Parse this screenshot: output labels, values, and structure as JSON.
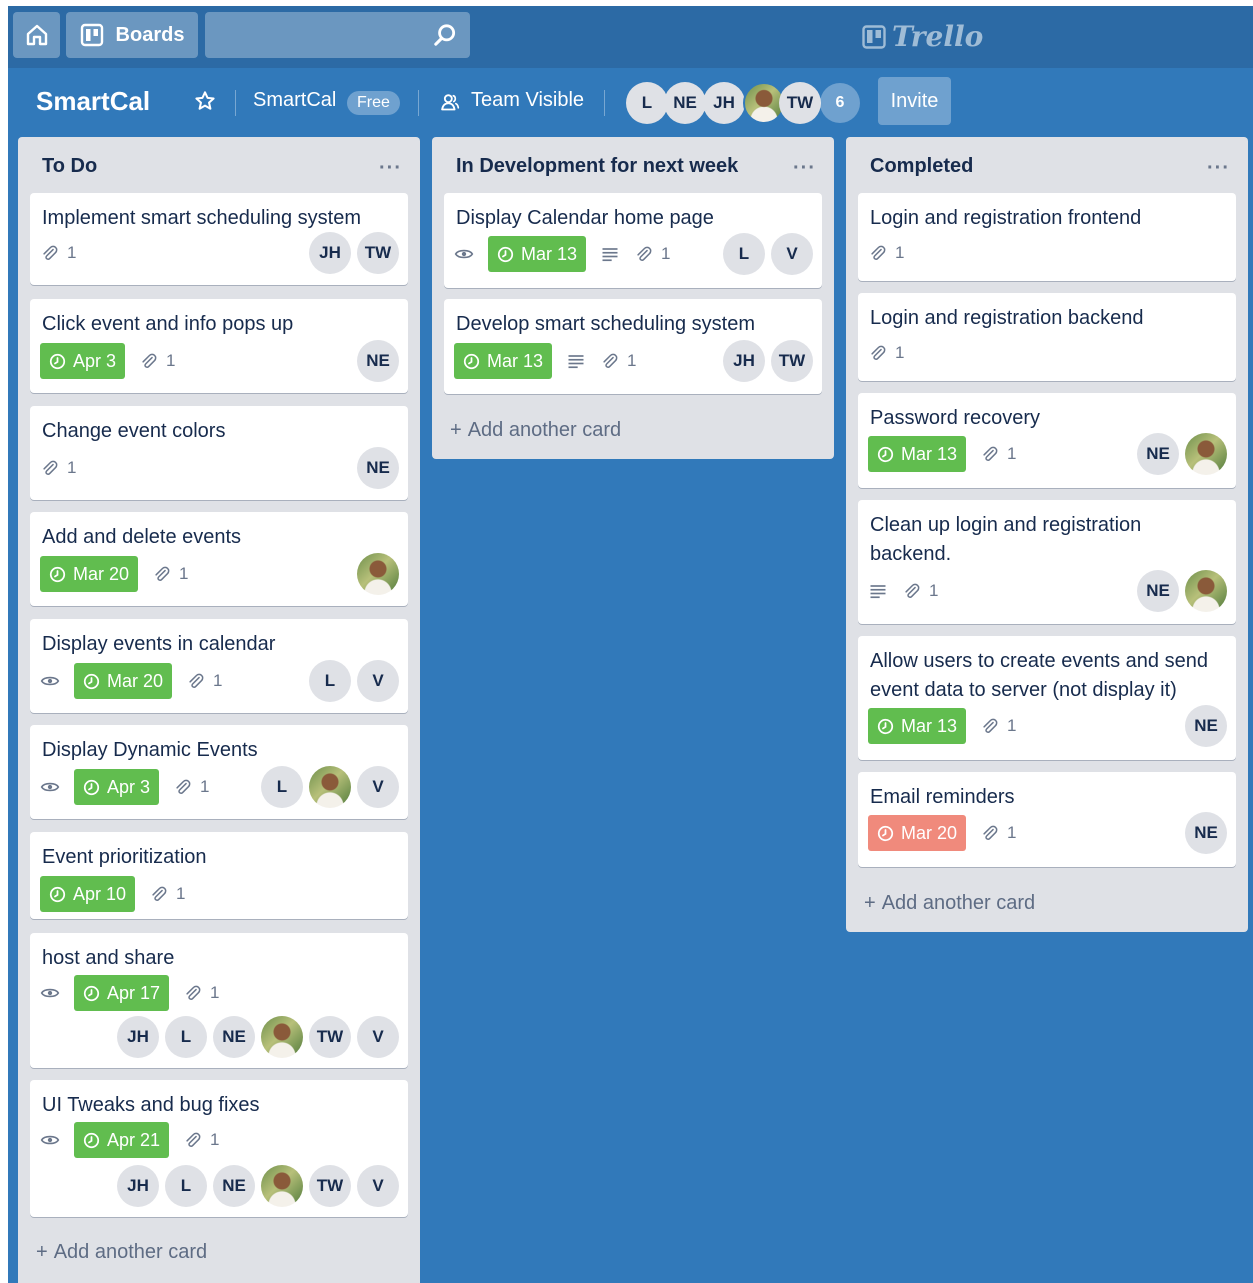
{
  "topbar": {
    "boards_label": "Boards",
    "logo_text": "Trello"
  },
  "board": {
    "title": "SmartCal",
    "team": "SmartCal",
    "plan": "Free",
    "visibility": "Team Visible",
    "member_initials": [
      "L",
      "NE",
      "JH",
      "",
      "TW"
    ],
    "member_count": "6",
    "invite_label": "Invite"
  },
  "colors": {
    "board_bg": "#3179ba",
    "due_green": "#61bd4f",
    "due_red": "#eb5a46",
    "list_bg": "#dfe1e6"
  },
  "lists": [
    {
      "title": "To Do",
      "add_label": "Add another card",
      "cards": [
        {
          "title": "Implement smart scheduling system",
          "attachments": "1",
          "members": [
            "JH",
            "TW"
          ]
        },
        {
          "title": "Click event and info pops up",
          "due": "Apr 3",
          "attachments": "1",
          "members": [
            "NE"
          ]
        },
        {
          "title": "Change event colors",
          "attachments": "1",
          "members": [
            "NE"
          ]
        },
        {
          "title": "Add and delete events",
          "due": "Mar 20",
          "attachments": "1",
          "members": [
            ""
          ]
        },
        {
          "title": "Display events in calendar",
          "due": "Mar 20",
          "attachments": "1",
          "watching": true,
          "members": [
            "L",
            "V"
          ]
        },
        {
          "title": "Display Dynamic Events",
          "due": "Apr 3",
          "attachments": "1",
          "watching": true,
          "members": [
            "L",
            "",
            "V"
          ]
        },
        {
          "title": "Event prioritization",
          "due": "Apr 10",
          "attachments": "1",
          "members": []
        },
        {
          "title": "host and share",
          "due": "Apr 17",
          "attachments": "1",
          "watching": true,
          "members": [
            "JH",
            "L",
            "NE",
            "",
            "TW",
            "V"
          ]
        },
        {
          "title": "UI Tweaks and bug fixes",
          "due": "Apr 21",
          "attachments": "1",
          "watching": true,
          "members": [
            "JH",
            "L",
            "NE",
            "",
            "TW",
            "V"
          ]
        }
      ]
    },
    {
      "title": "In Development for next week",
      "add_label": "Add another card",
      "cards": [
        {
          "title": "Display Calendar home page",
          "due": "Mar 13",
          "attachments": "1",
          "watching": true,
          "description": true,
          "members": [
            "L",
            "V"
          ]
        },
        {
          "title": "Develop smart scheduling system",
          "due": "Mar 13",
          "attachments": "1",
          "description": true,
          "members": [
            "JH",
            "TW"
          ]
        }
      ]
    },
    {
      "title": "Completed",
      "add_label": "Add another card",
      "cards": [
        {
          "title": "Login and registration frontend",
          "attachments": "1",
          "members": []
        },
        {
          "title": "Login and registration backend",
          "attachments": "1",
          "members": []
        },
        {
          "title": "Password recovery",
          "due": "Mar 13",
          "attachments": "1",
          "members": [
            "NE",
            ""
          ]
        },
        {
          "title": "Clean up login and registration backend.",
          "attachments": "1",
          "description": true,
          "members": [
            "NE",
            ""
          ]
        },
        {
          "title": "Allow users to create events and send event data to server (not display it)",
          "due": "Mar 13",
          "attachments": "1",
          "members": [
            "NE"
          ]
        },
        {
          "title": "Email reminders",
          "due": "Mar 20",
          "overdue": true,
          "attachments": "1",
          "members": [
            "NE"
          ]
        }
      ]
    }
  ]
}
